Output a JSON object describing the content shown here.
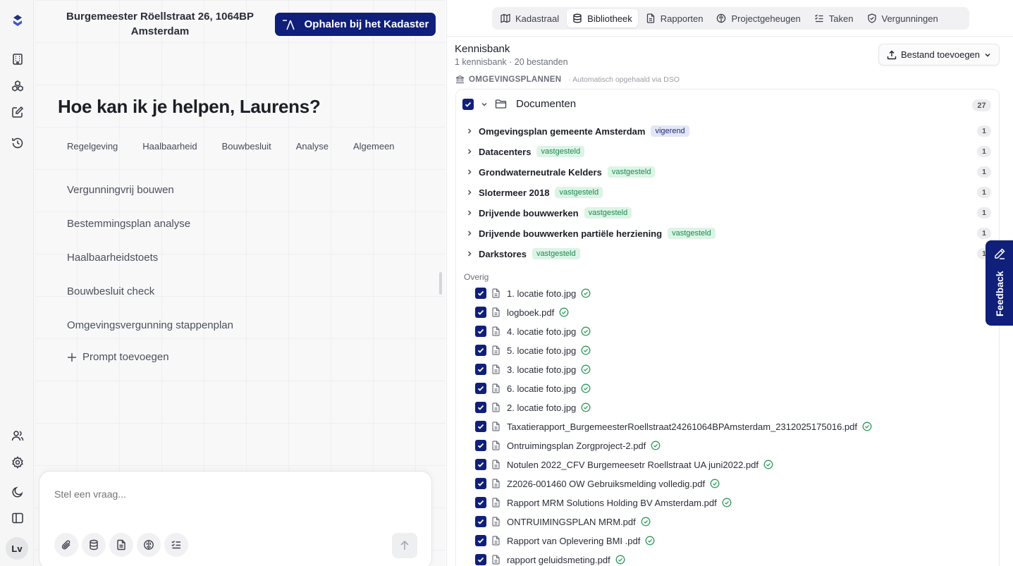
{
  "rail": {
    "avatar_initials": "Lv",
    "icons": [
      "logo-icon",
      "building-icon",
      "boxes-icon",
      "edit-icon",
      "history-icon",
      "users-icon",
      "settings-icon",
      "moon-icon",
      "sidebar-icon"
    ]
  },
  "chat": {
    "address_line1": "Burgemeester Röellstraat 26, 1064BP",
    "address_line2": "Amsterdam",
    "kadaster_button": "Ophalen bij het Kadaster",
    "greeting": "Hoe kan ik je helpen, Laurens?",
    "categories": [
      "Regelgeving",
      "Haalbaarheid",
      "Bouwbesluit",
      "Analyse",
      "Algemeen"
    ],
    "prompts": [
      "Vergunningvrij bouwen",
      "Bestemmingsplan analyse",
      "Haalbaarheidstoets",
      "Bouwbesluit check",
      "Omgevingsvergunning stappenplan"
    ],
    "add_prompt": "Prompt toevoegen",
    "input_placeholder": "Stel een vraag..."
  },
  "tabs": [
    {
      "label": "Kadastraal",
      "icon": "map-icon",
      "active": false
    },
    {
      "label": "Bibliotheek",
      "icon": "database-icon",
      "active": true
    },
    {
      "label": "Rapporten",
      "icon": "file-icon",
      "active": false
    },
    {
      "label": "Projectgeheugen",
      "icon": "brain-icon",
      "active": false
    },
    {
      "label": "Taken",
      "icon": "tasks-icon",
      "active": false
    },
    {
      "label": "Vergunningen",
      "icon": "shield-icon",
      "active": false
    }
  ],
  "library": {
    "title": "Kennisbank",
    "subtitle": "1 kennisbank · 20 bestanden",
    "add_button": "Bestand toevoegen",
    "section_label": "OMGEVINGSPLANNEN",
    "section_note": "· Automatisch opgehaald via DSO",
    "folder_name": "Documenten",
    "folder_count": "27",
    "plans": [
      {
        "name": "Omgevingsplan gemeente Amsterdam",
        "status": "vigerend",
        "count": "1"
      },
      {
        "name": "Datacenters",
        "status": "vastgesteld",
        "count": "1"
      },
      {
        "name": "Grondwaterneutrale Kelders",
        "status": "vastgesteld",
        "count": "1"
      },
      {
        "name": "Slotermeer 2018",
        "status": "vastgesteld",
        "count": "1"
      },
      {
        "name": "Drijvende bouwwerken",
        "status": "vastgesteld",
        "count": "1"
      },
      {
        "name": "Drijvende bouwwerken partiële herziening",
        "status": "vastgesteld",
        "count": "1"
      },
      {
        "name": "Darkstores",
        "status": "vastgesteld",
        "count": "1"
      }
    ],
    "other_label": "Overig",
    "files": [
      "1. locatie foto.jpg",
      "logboek.pdf",
      "4. locatie foto.jpg",
      "5. locatie foto.jpg",
      "3. locatie foto.jpg",
      "6. locatie foto.jpg",
      "2. locatie foto.jpg",
      "Taxatierapport_BurgemeesterRoellstraat24261064BPAmsterdam_2312025175016.pdf",
      "Ontruimingsplan Zorgproject-2.pdf",
      "Notulen 2022_CFV Burgemeesetr Roellstraat UA juni2022.pdf",
      "Z2026-001460 OW Gebruiksmelding volledig.pdf",
      "Rapport MRM Solutions Holding BV Amsterdam.pdf",
      "ONTRUIMINGSPLAN MRM.pdf",
      "Rapport van Oplevering BMI .pdf",
      "rapport geluidsmeting.pdf"
    ]
  },
  "feedback_label": "Feedback",
  "colors": {
    "brand": "#0f1f7a",
    "badge_vigerend_bg": "#e2e6f6",
    "badge_vastgesteld_bg": "#dcf4e6",
    "check_green": "#2f9a5c"
  }
}
